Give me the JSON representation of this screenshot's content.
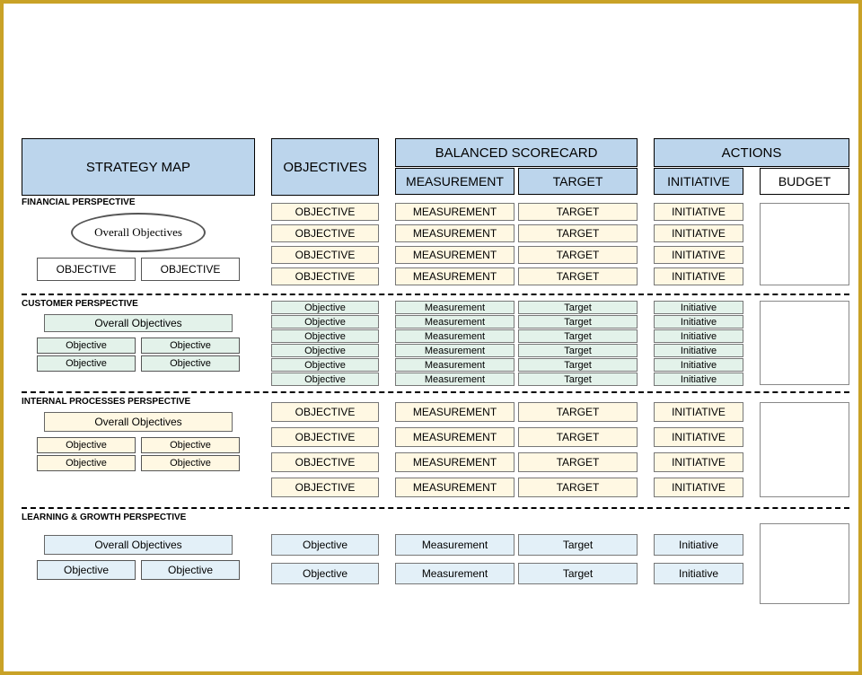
{
  "headers": {
    "strategy": "STRATEGY MAP",
    "objectives": "OBJECTIVES",
    "scorecard": "BALANCED SCORECARD",
    "measurement": "MEASUREMENT",
    "target": "TARGET",
    "actions": "ACTIONS",
    "initiative": "INITIATIVE",
    "budget": "BUDGET"
  },
  "perspectives": {
    "financial": {
      "label": "FINANCIAL PERSPECTIVE",
      "overall": "Overall Objectives",
      "obj": "OBJECTIVE",
      "meas": "MEASUREMENT",
      "targ": "TARGET",
      "init": "INITIATIVE"
    },
    "customer": {
      "label": "CUSTOMER PERSPECTIVE",
      "overall": "Overall Objectives",
      "obj": "Objective",
      "meas": "Measurement",
      "targ": "Target",
      "init": "Initiative"
    },
    "internal": {
      "label": "INTERNAL PROCESSES PERSPECTIVE",
      "overall": "Overall Objectives",
      "obj": "OBJECTIVE",
      "objlc": "Objective",
      "meas": "MEASUREMENT",
      "targ": "TARGET",
      "init": "INITIATIVE"
    },
    "learning": {
      "label": "LEARNING & GROWTH PERSPECTIVE",
      "overall": "Overall Objectives",
      "obj": "Objective",
      "meas": "Measurement",
      "targ": "Target",
      "init": "Initiative"
    }
  }
}
